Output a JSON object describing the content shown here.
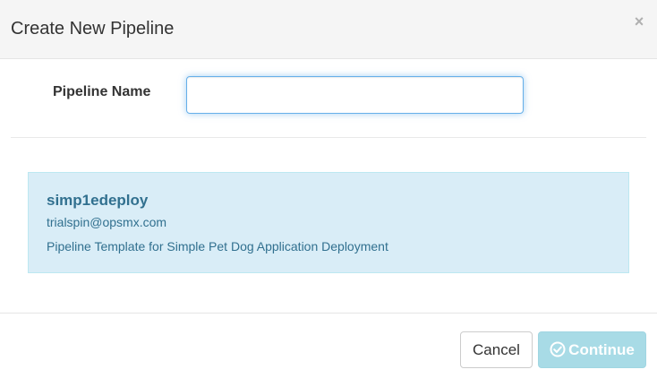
{
  "modal": {
    "title": "Create New Pipeline",
    "close_label": "×"
  },
  "form": {
    "pipeline_name_label": "Pipeline Name",
    "pipeline_name_value": "",
    "pipeline_name_placeholder": ""
  },
  "template": {
    "name": "simp1edeploy",
    "owner": "trialspin@opsmx.com",
    "description": "Pipeline Template for Simple Pet Dog Application Deployment"
  },
  "footer": {
    "cancel_label": "Cancel",
    "continue_label": "Continue",
    "continue_icon": "check-circle-icon"
  },
  "colors": {
    "card_background": "#d9edf7",
    "card_text": "#31708f",
    "continue_button": "#a8dbe6",
    "input_focus_border": "#66afe9"
  }
}
